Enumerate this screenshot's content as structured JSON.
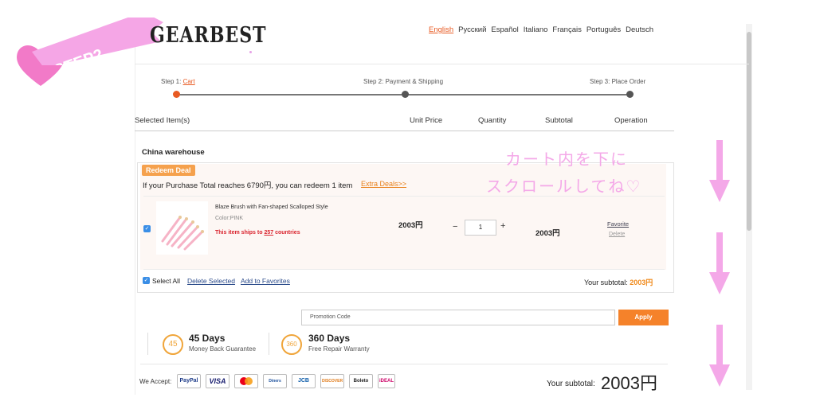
{
  "step_ribbon": {
    "label": "STEP2"
  },
  "header": {
    "logo": "GEARBEST",
    "languages": [
      {
        "label": "English",
        "active": true
      },
      {
        "label": "Русский"
      },
      {
        "label": "Español"
      },
      {
        "label": "Italiano"
      },
      {
        "label": "Français"
      },
      {
        "label": "Português"
      },
      {
        "label": "Deutsch"
      }
    ]
  },
  "steps": {
    "step1_prefix": "Step 1: ",
    "step1_link": "Cart",
    "step2": "Step 2: Payment & Shipping",
    "step3": "Step 3: Place Order"
  },
  "table_header": {
    "selected_items": "Selected Item(s)",
    "unit_price": "Unit Price",
    "quantity": "Quantity",
    "subtotal": "Subtotal",
    "operation": "Operation"
  },
  "warehouse": "China warehouse",
  "redeem": {
    "badge": "Redeem Deal",
    "text": "If your Purchase Total reaches 6790円, you can redeem 1 item",
    "link": "Extra Deals>>"
  },
  "item": {
    "name": "Blaze Brush with Fan-shaped Scalloped Style",
    "color": "Color:PINK",
    "ships_prefix": "This item ships to ",
    "ships_count": "257",
    "ships_suffix": " countries",
    "unit_price": "2003円",
    "quantity": "1",
    "subtotal": "2003円",
    "favorite": "Favorite",
    "delete": "Delete"
  },
  "cart_footer": {
    "select_all": "Select All",
    "delete_selected": "Delete Selected",
    "add_to_favorites": "Add to Favorites",
    "your_subtotal_label": "Your subtotal: ",
    "your_subtotal_value": "2003円"
  },
  "promo": {
    "placeholder": "Promotion Code",
    "apply": "Apply"
  },
  "guarantees": [
    {
      "icon": "45",
      "title": "45 Days",
      "subtitle": "Money Back Guarantee"
    },
    {
      "icon": "360",
      "title": "360 Days",
      "subtitle": "Free Repair Warranty"
    }
  ],
  "payments": {
    "label": "We Accept:",
    "methods": [
      "PayPal",
      "VISA",
      "MC",
      "Diners",
      "JCB",
      "DISCOVER",
      "Boleto",
      "iDEAL"
    ]
  },
  "bottom": {
    "subtotal_label": "Your subtotal:",
    "subtotal_value": "2003円"
  },
  "annotation": {
    "line1": "カート内を下に",
    "line2": "スクロールしてね♡"
  },
  "colors": {
    "accent": "#e85a22",
    "orange": "#f5822a",
    "pink": "#f4a8e8"
  }
}
